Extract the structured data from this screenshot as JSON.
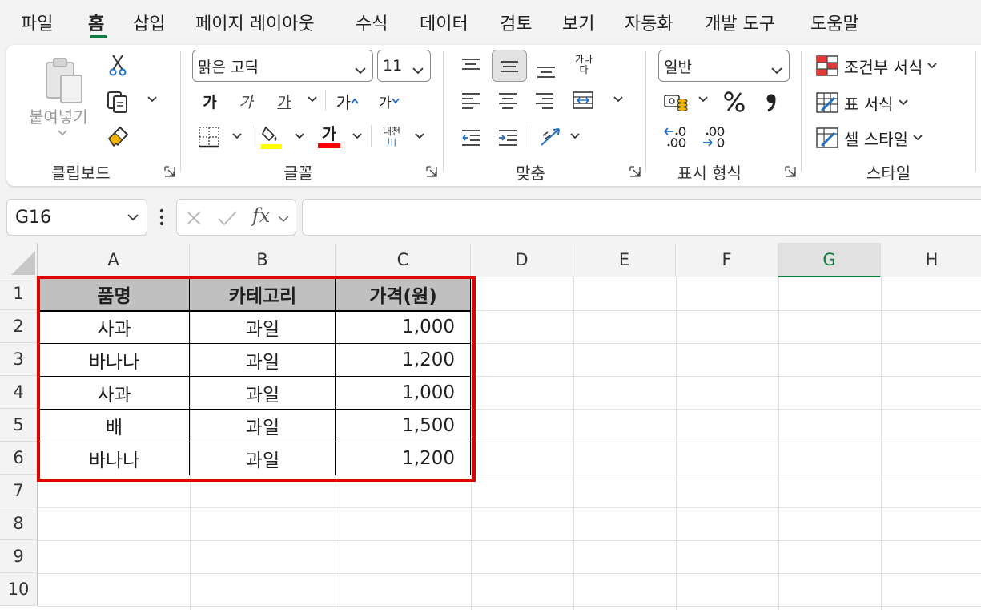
{
  "tabs": [
    "파일",
    "홈",
    "삽입",
    "페이지 레이아웃",
    "수식",
    "데이터",
    "검토",
    "보기",
    "자동화",
    "개발 도구",
    "도움말"
  ],
  "active_tab": "홈",
  "ribbon": {
    "clipboard": {
      "label": "클립보드",
      "paste_label": "붙여넣기"
    },
    "font": {
      "label": "글꼴",
      "font_name": "맑은 고딕",
      "font_size": "11",
      "bold": "가",
      "italic": "가",
      "underline": "가",
      "grow": "가",
      "shrink": "가",
      "font_color": "가",
      "phonetic_top": "내천",
      "phonetic_bottom": "川",
      "fill_color": "#ffff00",
      "text_color": "#ff0000"
    },
    "alignment": {
      "label": "맞춤",
      "wrap_top": "가나",
      "wrap_bottom": "다"
    },
    "number": {
      "label": "표시 형식",
      "format": "일반"
    },
    "styles": {
      "label": "스타일",
      "conditional": "조건부 서식",
      "table": "표 서식",
      "cell": "셀 스타일"
    }
  },
  "formula_bar": {
    "name_box": "G16",
    "fx": "fx",
    "value": ""
  },
  "columns": [
    "A",
    "B",
    "C",
    "D",
    "E",
    "F",
    "G",
    "H"
  ],
  "selected_column": "G",
  "rows": [
    "1",
    "2",
    "3",
    "4",
    "5",
    "6",
    "7",
    "8",
    "9",
    "10"
  ],
  "table": {
    "headers": [
      "품명",
      "카테고리",
      "가격(원)"
    ],
    "rows": [
      [
        "사과",
        "과일",
        "1,000"
      ],
      [
        "바나나",
        "과일",
        "1,200"
      ],
      [
        "사과",
        "과일",
        "1,000"
      ],
      [
        "배",
        "과일",
        "1,500"
      ],
      [
        "바나나",
        "과일",
        "1,200"
      ]
    ]
  },
  "colors": {
    "accent": "#107c41",
    "highlight_border": "#e00000",
    "header_fill": "#c0c0c0"
  }
}
